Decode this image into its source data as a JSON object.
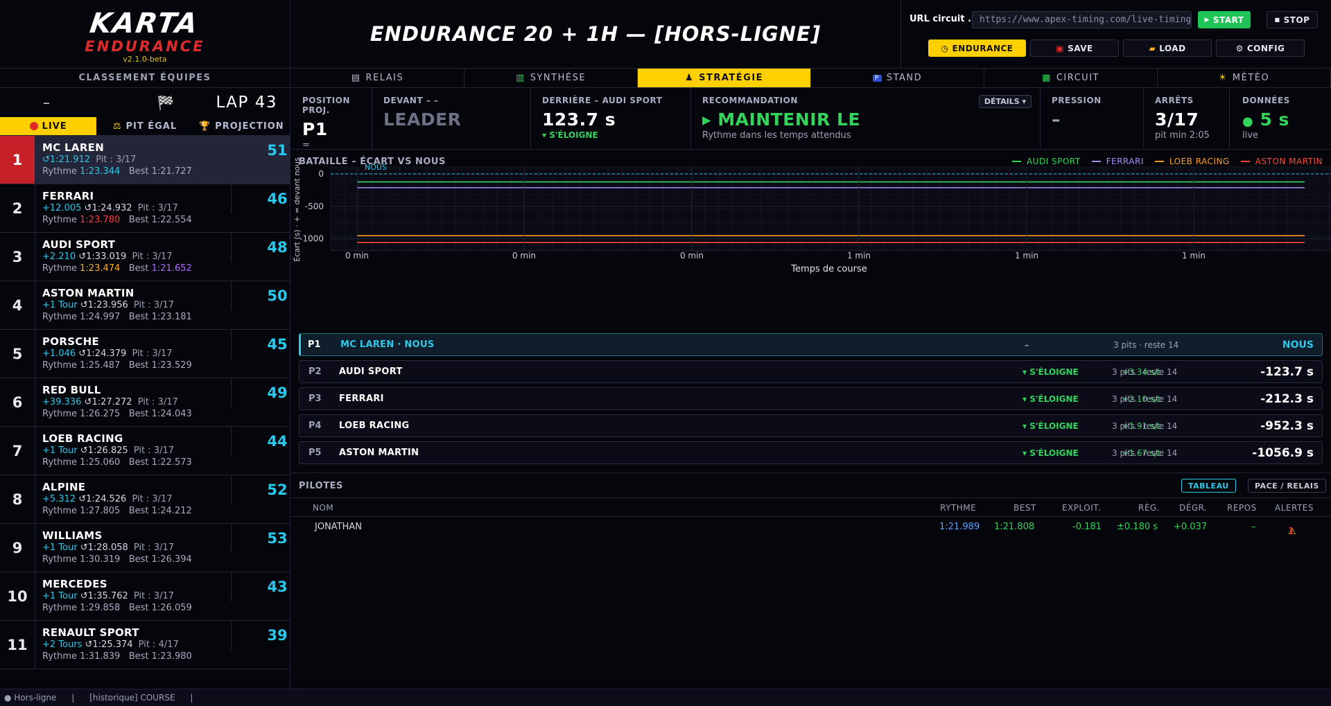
{
  "brand": {
    "karta": "KARTA",
    "endurance": "ENDURANCE",
    "version": "v2.1.0-beta"
  },
  "title": "ENDURANCE 20 + 1H  —  [HORS-LIGNE]",
  "controls": {
    "url_label": "URL circuit .",
    "url_value": "https://www.apex-timing.com/live-timing/...",
    "start": "START",
    "stop": "STOP",
    "endurance": "ENDURANCE",
    "save": "SAVE",
    "load": "LOAD",
    "config": "CONFIG"
  },
  "nav": {
    "tabs": [
      "RELAIS",
      "SYNTHÈSE",
      "STRATÉGIE",
      "STAND",
      "CIRCUIT",
      "MÉTÉO"
    ],
    "active": "STRATÉGIE"
  },
  "left": {
    "header": "CLASSEMENT ÉQUIPES",
    "dash": "–",
    "lap": "LAP 43",
    "tabs": [
      "LIVE",
      "PIT ÉGAL",
      "PROJECTION"
    ],
    "teams": [
      {
        "pos": "1",
        "name": "MC LAREN",
        "gap": "",
        "last": "1:21.912",
        "pit": "Pit : 3/17",
        "rythme": "1:23.344",
        "rythme_color": "cyan",
        "best": "1:21.727",
        "best_color": "",
        "lap": "51"
      },
      {
        "pos": "2",
        "name": "FERRARI",
        "gap": "+12.005",
        "last": "1:24.932",
        "pit": "Pit : 3/17",
        "rythme": "1:23.780",
        "rythme_color": "red",
        "best": "1:22.554",
        "best_color": "",
        "lap": "46"
      },
      {
        "pos": "3",
        "name": "AUDI SPORT",
        "gap": "+2.210",
        "last": "1:33.019",
        "pit": "Pit : 3/17",
        "rythme": "1:23.474",
        "rythme_color": "yellow",
        "best": "1:21.652",
        "best_color": "purple",
        "lap": "48"
      },
      {
        "pos": "4",
        "name": "ASTON MARTIN",
        "gap": "+1 Tour",
        "last": "1:23.956",
        "pit": "Pit : 3/17",
        "rythme": "1:24.997",
        "rythme_color": "",
        "best": "1:23.181",
        "best_color": "",
        "lap": "50"
      },
      {
        "pos": "5",
        "name": "PORSCHE",
        "gap": "+1.046",
        "last": "1:24.379",
        "pit": "Pit : 3/17",
        "rythme": "1:25.487",
        "rythme_color": "",
        "best": "1:23.529",
        "best_color": "",
        "lap": "45"
      },
      {
        "pos": "6",
        "name": "RED BULL",
        "gap": "+39.336",
        "last": "1:27.272",
        "pit": "Pit : 3/17",
        "rythme": "1:26.275",
        "rythme_color": "",
        "best": "1:24.043",
        "best_color": "",
        "lap": "49"
      },
      {
        "pos": "7",
        "name": "LOEB RACING",
        "gap": "+1 Tour",
        "last": "1:26.825",
        "pit": "Pit : 3/17",
        "rythme": "1:25.060",
        "rythme_color": "",
        "best": "1:22.573",
        "best_color": "",
        "lap": "44"
      },
      {
        "pos": "8",
        "name": "ALPINE",
        "gap": "+5.312",
        "last": "1:24.526",
        "pit": "Pit : 3/17",
        "rythme": "1:27.805",
        "rythme_color": "",
        "best": "1:24.212",
        "best_color": "",
        "lap": "52"
      },
      {
        "pos": "9",
        "name": "WILLIAMS",
        "gap": "+1 Tour",
        "last": "1:28.058",
        "pit": "Pit : 3/17",
        "rythme": "1:30.319",
        "rythme_color": "",
        "best": "1:26.394",
        "best_color": "",
        "lap": "53"
      },
      {
        "pos": "10",
        "name": "MERCEDES",
        "gap": "+1 Tour",
        "last": "1:35.762",
        "pit": "Pit : 3/17",
        "rythme": "1:29.858",
        "rythme_color": "",
        "best": "1:26.059",
        "best_color": "",
        "lap": "43"
      },
      {
        "pos": "11",
        "name": "RENAULT SPORT",
        "gap": "+2 Tours",
        "last": "1:25.374",
        "pit": "Pit : 4/17",
        "rythme": "1:31.839",
        "rythme_color": "",
        "best": "1:23.980",
        "best_color": "",
        "lap": "39"
      }
    ]
  },
  "metrics": {
    "position": {
      "label": "POSITION PROJ.",
      "value": "P1",
      "sub": "="
    },
    "devant": {
      "label": "DEVANT – –",
      "value": "LEADER"
    },
    "derriere": {
      "label": "DERRIÈRE – AUDI SPORT",
      "value": "123.7 s",
      "sub": "▾ S'ÉLOIGNE"
    },
    "reco": {
      "label": "RECOMMANDATION",
      "value": "▸ MAINTENIR LE",
      "sub": "Rythme dans les temps attendus",
      "details": "DÉTAILS ▾"
    },
    "pression": {
      "label": "PRESSION",
      "value": "–"
    },
    "arrets": {
      "label": "ARRÊTS",
      "value": "3/17",
      "sub": "pit min 2:05"
    },
    "donnees": {
      "label": "DONNÉES",
      "value": "5 s",
      "sub": "live"
    }
  },
  "chart_data": {
    "type": "line",
    "title": "BATAILLE – ÉCART VS NOUS",
    "xlabel": "Temps de course",
    "ylabel": "Écart (s) · + = devant nous",
    "x_ticks": [
      "0 min",
      "0 min",
      "0 min",
      "1 min",
      "1 min",
      "1 min"
    ],
    "y_ticks": [
      "0",
      "-500",
      "-1000"
    ],
    "ylim": [
      -1100,
      0
    ],
    "legend_position": "top-right",
    "reference_label": "NOUS",
    "series": [
      {
        "name": "AUDI SPORT",
        "color": "#34d35c",
        "values": [
          -123.7,
          -123.7
        ]
      },
      {
        "name": "FERRARI",
        "color": "#a98cff",
        "values": [
          -212.3,
          -212.3
        ]
      },
      {
        "name": "LOEB RACING",
        "color": "#ffa020",
        "values": [
          -952.3,
          -952.3
        ]
      },
      {
        "name": "ASTON MARTIN",
        "color": "#ff4a3a",
        "values": [
          -1056.9,
          -1056.9
        ]
      }
    ]
  },
  "battle": [
    {
      "pos": "P1",
      "name": "MC LAREN · NOUS",
      "trend": "–",
      "rate": "–",
      "pits": "3 pits · reste 14",
      "gap": "NOUS",
      "us": true
    },
    {
      "pos": "P2",
      "name": "AUDI SPORT",
      "trend": "▾ S'ÉLOIGNE",
      "rate": "+3.34 s/t",
      "pits": "3 pits · reste 14",
      "gap": "-123.7 s"
    },
    {
      "pos": "P3",
      "name": "FERRARI",
      "trend": "▾ S'ÉLOIGNE",
      "rate": "+2.10 s/t",
      "pits": "3 pits · reste 14",
      "gap": "-212.3 s"
    },
    {
      "pos": "P4",
      "name": "LOEB RACING",
      "trend": "▾ S'ÉLOIGNE",
      "rate": "+1.91 s/t",
      "pits": "3 pits · reste 14",
      "gap": "-952.3 s"
    },
    {
      "pos": "P5",
      "name": "ASTON MARTIN",
      "trend": "▾ S'ÉLOIGNE",
      "rate": "+1.67 s/t",
      "pits": "3 pits · reste 14",
      "gap": "-1056.9 s"
    }
  ],
  "pilots": {
    "title": "PILOTES",
    "tabs": [
      "TABLEAU",
      "PACE / RELAIS"
    ],
    "columns": [
      "NOM",
      "RYTHME",
      "BEST",
      "EXPLOIT.",
      "RÉG.",
      "DÉGR.",
      "REPOS",
      "ALERTES"
    ],
    "rows": [
      {
        "nom": "JONATHAN",
        "rythme": "1:21.989",
        "best": "1:21.808",
        "exploit": "-0.181",
        "reg": "±0.180 s",
        "degr": "+0.037",
        "repos": "–",
        "alertes": "1"
      }
    ]
  },
  "status": {
    "state": "● Hors-ligne",
    "sep": "|",
    "mode": "[historique] COURSE",
    "sep2": "|"
  },
  "colors": {
    "accent": "#ffd000",
    "cyan": "#2ec9e8",
    "green": "#34d35c",
    "red": "#e02b2b"
  }
}
